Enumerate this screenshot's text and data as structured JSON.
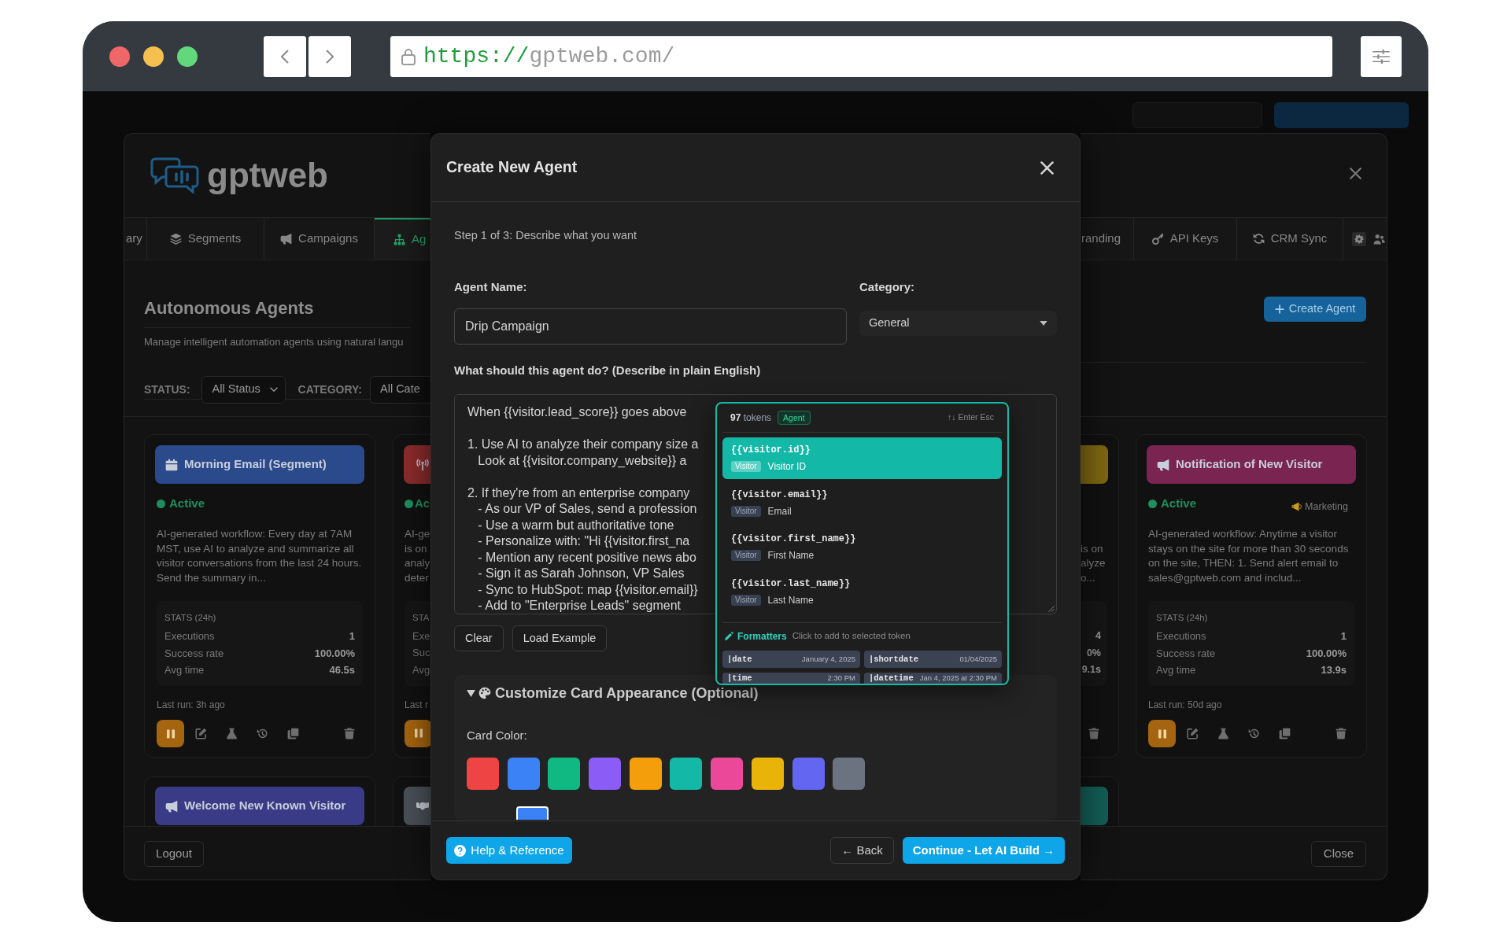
{
  "browser": {
    "url": {
      "scheme": "https://",
      "rest": "gptweb.com/"
    }
  },
  "app": {
    "left_side": {
      "logo": "gptweb",
      "tabs": [
        {
          "label": "ary",
          "selected": false
        },
        {
          "label": "Segments",
          "selected": false
        },
        {
          "label": "Campaigns",
          "selected": false
        },
        {
          "label": "Ag",
          "selected": true
        }
      ],
      "title": "Autonomous Agents",
      "subtitle": "Manage intelligent automation agents using natural langu",
      "filters": [
        {
          "label": "STATUS:",
          "value": "All Status"
        },
        {
          "label": "CATEGORY:",
          "value": "All Cate"
        }
      ],
      "card_rows": [
        [
          {
            "kind": "full",
            "title": "Morning Email (Segment)",
            "color": "#2a4a8c",
            "status": "Active",
            "description": "AI-generated workflow: Every day at 7AM MST, use AI to analyze and summarize all visitor conversations from the last 24 hours. Send the summary in...",
            "stats_title": "STATS (24h)",
            "stats": [
              {
                "label": "Executions",
                "value": "1"
              },
              {
                "label": "Success rate",
                "value": "100.00%"
              },
              {
                "label": "Avg time",
                "value": "46.5s"
              }
            ],
            "last_run": "Last run: 3h ago"
          },
          {
            "kind": "cut_right",
            "color": "#8c2b2b",
            "status": "Ac",
            "description_lines": [
              "AI-ge",
              "is on",
              "analy",
              "deter"
            ],
            "stats_title": "STA",
            "stats": [
              {
                "label": "Exe"
              },
              {
                "label": "Suc"
              },
              {
                "label": "Avg"
              }
            ],
            "last_run": "Last r"
          }
        ],
        [
          {
            "kind": "peek",
            "title": "Welcome New Known Visitor",
            "color": "#393b87"
          },
          {
            "kind": "peek_cut_right",
            "color": "#4b5059"
          }
        ]
      ],
      "footer_button": "Logout"
    },
    "right_side": {
      "tabs": [
        {
          "label": "randing",
          "selected": false
        },
        {
          "label": "API Keys",
          "selected": false
        },
        {
          "label": "CRM Sync",
          "selected": false
        }
      ],
      "create_button": "Create Agent",
      "card_rows": [
        [
          {
            "kind": "cut_left",
            "color": "#7d6612",
            "description_lines": [
              "is on",
              "alyze",
              "o..."
            ],
            "stats": [
              {
                "value": "4"
              },
              {
                "value": "0%"
              },
              {
                "value": "9.1s"
              }
            ]
          },
          {
            "kind": "full",
            "title": "Notification of New Visitor",
            "color": "#7a2452",
            "status": "Active",
            "category": "Marketing",
            "description": "AI-generated workflow: Anytime a visitor stays on the site for more than 30 seconds on the site, THEN: 1. Send alert email to sales@gptweb.com and includ...",
            "stats_title": "STATS (24h)",
            "stats": [
              {
                "label": "Executions",
                "value": "1"
              },
              {
                "label": "Success rate",
                "value": "100.00%"
              },
              {
                "label": "Avg time",
                "value": "13.9s"
              }
            ],
            "last_run": "Last run: 50d ago"
          }
        ],
        [
          {
            "kind": "peek_cut_left",
            "color": "#125e55"
          }
        ]
      ],
      "footer_button": "Close"
    }
  },
  "modal": {
    "title": "Create New Agent",
    "step": "Step 1 of 3: Describe what you want",
    "name_field": {
      "label": "Agent Name:",
      "value": "Drip Campaign"
    },
    "category_field": {
      "label": "Category:",
      "value": "General"
    },
    "prompt_field": {
      "label": "What should this agent do? (Describe in plain English)",
      "value": "When {{visitor.lead_score}} goes above\n\n1. Use AI to analyze their company size a\n   Look at {{visitor.company_website}} a\n\n2. If they're from an enterprise company\n   - As our VP of Sales, send a profession\n   - Use a warm but authoritative tone\n   - Personalize with: \"Hi {{visitor.first_na\n   - Mention any recent positive news abo\n   - Sign it as Sarah Johnson, VP Sales\n   - Sync to HubSpot: map {{visitor.email}}\n   - Add to \"Enterprise Leads\" segment"
    },
    "prompt_buttons": [
      "Clear",
      "Load Example"
    ],
    "token_menu": {
      "count": "**97** tokens",
      "badge": "Agent",
      "hint": "↑↓ Enter Esc",
      "items": [
        {
          "token": "{{visitor.id}}",
          "group": "Visitor",
          "label": "Visitor ID",
          "selected": true
        },
        {
          "token": "{{visitor.email}}",
          "group": "Visitor",
          "label": "Email",
          "selected": false
        },
        {
          "token": "{{visitor.first_name}}",
          "group": "Visitor",
          "label": "First Name",
          "selected": false
        },
        {
          "token": "{{visitor.last_name}}",
          "group": "Visitor",
          "label": "Last Name",
          "selected": false
        }
      ],
      "formatters_title": "Formatters",
      "formatters_hint": "Click to add to selected token",
      "formatters": [
        {
          "name": "|date",
          "example": "January 4, 2025"
        },
        {
          "name": "|shortdate",
          "example": "01/04/2025"
        },
        {
          "name": "|time",
          "example": "2:30 PM"
        },
        {
          "name": "|datetime",
          "example": "Jan 4, 2025 at 2:30 PM"
        }
      ]
    },
    "appearance": {
      "expanded": true,
      "title": "Customize Card Appearance (Optional)",
      "color_label": "Card Color:",
      "swatches": [
        {
          "color": "#ef4444"
        },
        {
          "color": "#3b82f6"
        },
        {
          "color": "#10b981"
        },
        {
          "color": "#8b5cf6"
        },
        {
          "color": "#f59e0b"
        },
        {
          "color": "#14b8a6"
        },
        {
          "color": "#ec4899"
        },
        {
          "color": "#eab308"
        },
        {
          "color": "#6366f1"
        },
        {
          "color": "#6b7280"
        }
      ],
      "custom_picker": {
        "color": "#3b82f6"
      }
    },
    "footer": {
      "help": "Help & Reference",
      "back": "← Back",
      "continue": "Continue - Let AI Build →"
    }
  }
}
